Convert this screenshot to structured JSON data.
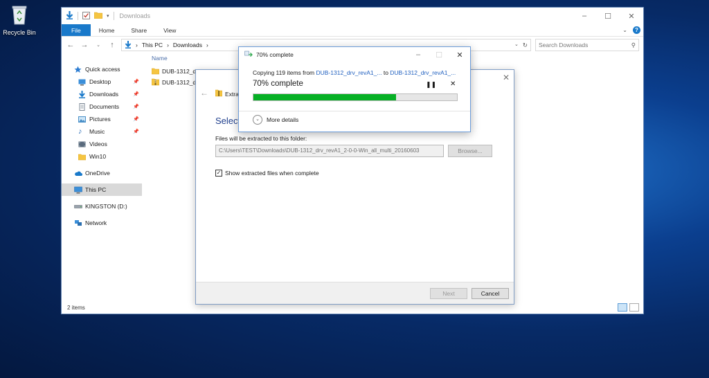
{
  "desktop": {
    "recycle_bin_label": "Recycle Bin"
  },
  "explorer": {
    "title": "Downloads",
    "ribbon_tabs": [
      "File",
      "Home",
      "Share",
      "View"
    ],
    "address": {
      "segments": [
        "This PC",
        "Downloads"
      ]
    },
    "search_placeholder": "Search Downloads",
    "sidebar": {
      "quick_access": "Quick access",
      "items": [
        "Desktop",
        "Downloads",
        "Documents",
        "Pictures",
        "Music",
        "Videos",
        "Win10"
      ],
      "onedrive": "OneDrive",
      "this_pc": "This PC",
      "drive": "KINGSTON (D:)",
      "network": "Network"
    },
    "column_header": "Name",
    "files": [
      "DUB-1312_d",
      "DUB-1312_d"
    ],
    "status": "2 items"
  },
  "wizard": {
    "title": "Extract",
    "heading": "Select",
    "dest_label": "Files will be extracted to this folder:",
    "path": "C:\\Users\\TEST\\Downloads\\DUB-1312_drv_revA1_2-0-0-Win_all_multi_20160603",
    "browse": "Browse...",
    "show_files_label": "Show extracted files when complete",
    "next": "Next",
    "cancel": "Cancel"
  },
  "progress": {
    "title": "70% complete",
    "copying_prefix": "Copying 119 items from ",
    "source": "DUB-1312_drv_revA1_...",
    "to": " to ",
    "dest": "DUB-1312_drv_revA1_...",
    "percent_text": "70% complete",
    "percent": 0.7,
    "more_details": "More details"
  },
  "colors": {
    "accent": "#1979ca",
    "progress_green": "#06b025",
    "heading_blue": "#1e3e8c"
  }
}
